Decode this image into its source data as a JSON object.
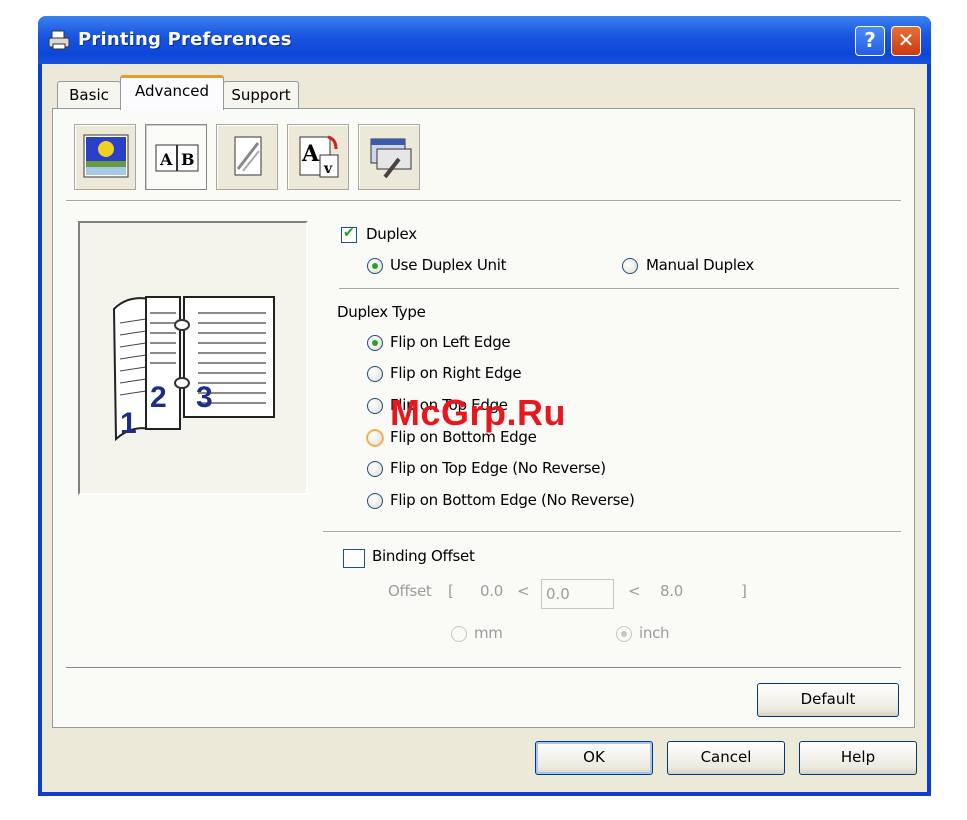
{
  "window": {
    "title": "Printing Preferences"
  },
  "caption_buttons": {
    "help": "?",
    "close": "✕"
  },
  "tabs": [
    {
      "label": "Basic"
    },
    {
      "label": "Advanced"
    },
    {
      "label": "Support"
    }
  ],
  "toolbar_icons": [
    "print-quality-icon",
    "duplex-icon",
    "watermark-icon",
    "page-setting-icon",
    "device-options-icon"
  ],
  "duplex": {
    "checkbox_label": "Duplex",
    "checked": true,
    "use_duplex_unit": "Use Duplex Unit",
    "manual_duplex": "Manual Duplex",
    "type_heading": "Duplex Type",
    "options": [
      "Flip on Left Edge",
      "Flip on Right Edge",
      "Flip on Top Edge",
      "Flip on Bottom Edge",
      "Flip on Top Edge (No Reverse)",
      "Flip on Bottom Edge (No Reverse)"
    ],
    "selected": "Flip on Left Edge"
  },
  "preview": {
    "page_numbers": [
      "1",
      "2",
      "3"
    ]
  },
  "binding_offset": {
    "checkbox_label": "Binding Offset",
    "checked": false,
    "offset_label": "Offset",
    "open_bracket": "[",
    "min": "0.0",
    "lt1": "<",
    "value": "0.0",
    "lt2": "<",
    "max": "8.0",
    "close_bracket": "]",
    "unit_mm": "mm",
    "unit_inch": "inch",
    "selected_unit": "inch"
  },
  "buttons": {
    "default": "Default",
    "ok": "OK",
    "cancel": "Cancel",
    "help": "Help"
  },
  "watermark_text": "McGrp.Ru",
  "colors": {
    "title_bar": "#0c46d8",
    "close": "#c83a14",
    "radio_selected": "#2f9e2a",
    "tab_highlight": "#e79b30",
    "watermark": "#e8161e"
  }
}
